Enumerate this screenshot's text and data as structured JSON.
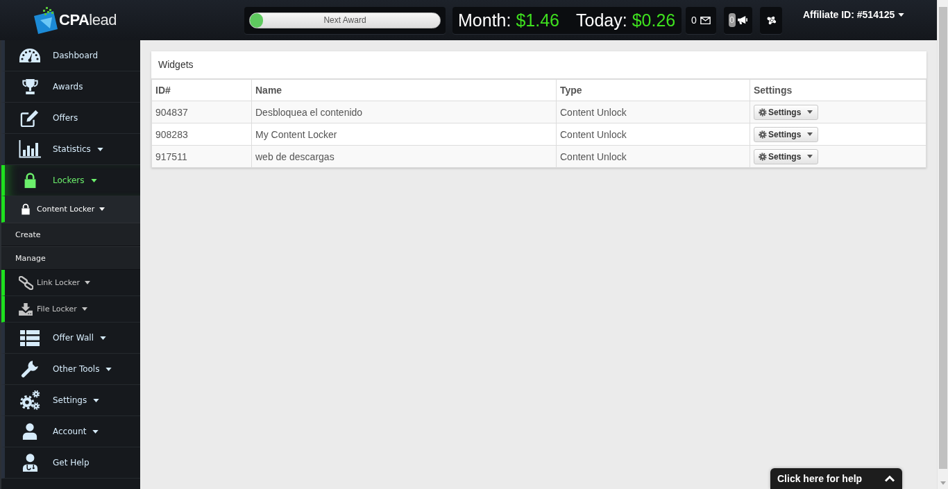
{
  "header": {
    "logo": "**CPA**lead",
    "award_progress": {
      "label": "Next Award",
      "level": 0.07
    },
    "earnings": [
      {
        "label": "Month:",
        "value": "$1.46"
      },
      {
        "label": "Today:",
        "value": "$0.26"
      }
    ],
    "messages": {
      "count": "0"
    },
    "announcements": {
      "count": "0"
    },
    "affiliate_menu": {
      "label": "Affiliate ID: #514125"
    }
  },
  "sidebar": {
    "items": [
      {
        "label": "Dashboard",
        "has_menu": false,
        "selected": false
      },
      {
        "label": "Awards",
        "has_menu": false,
        "selected": false
      },
      {
        "label": "Offers",
        "has_menu": false,
        "selected": false
      },
      {
        "label": "Statistics",
        "has_menu": true,
        "selected": false
      },
      {
        "label": "Lockers",
        "has_menu": true,
        "selected": true,
        "children": [
          {
            "label": "Content Locker",
            "has_menu": true,
            "selected": true,
            "children": [
              {
                "label": "Create",
                "selected": false
              },
              {
                "label": "Manage",
                "selected": false
              }
            ]
          },
          {
            "label": "Link Locker",
            "has_menu": true,
            "selected": false
          },
          {
            "label": "File Locker",
            "has_menu": true,
            "selected": false
          }
        ]
      },
      {
        "label": "Offer Wall",
        "has_menu": true,
        "selected": false
      },
      {
        "label": "Other Tools",
        "has_menu": true,
        "selected": false
      },
      {
        "label": "Settings",
        "has_menu": true,
        "selected": false
      },
      {
        "label": "Account",
        "has_menu": true,
        "selected": false
      },
      {
        "label": "Get Help",
        "has_menu": false,
        "selected": false
      }
    ]
  },
  "panel": {
    "title": "Widgets",
    "table": {
      "columns": [
        "ID#",
        "Name",
        "Type",
        "Settings"
      ],
      "rows": [
        {
          "id": "904837",
          "name": "Desbloquea el contenido",
          "type": "Content Unlock",
          "action": "Settings"
        },
        {
          "id": "908283",
          "name": "My Content Locker",
          "type": "Content Unlock",
          "action": "Settings"
        },
        {
          "id": "917511",
          "name": "web de descargas",
          "type": "Content Unlock",
          "action": "Settings"
        }
      ]
    }
  },
  "help_tab": {
    "label": "Click here for help"
  }
}
